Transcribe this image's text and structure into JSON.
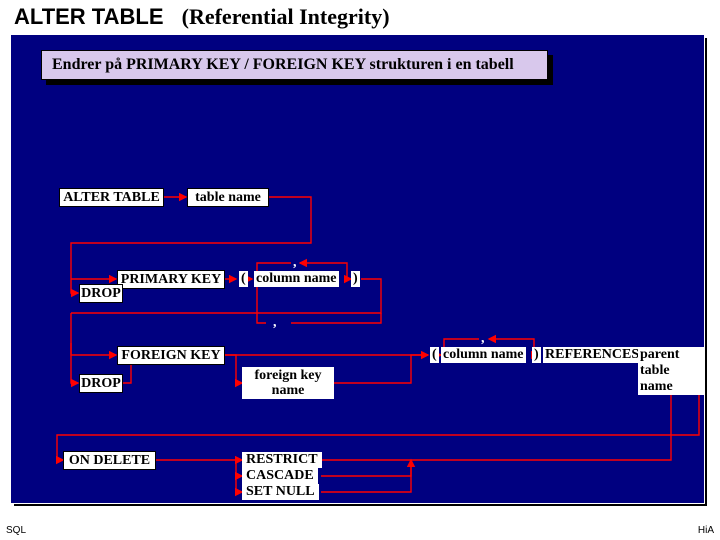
{
  "title": {
    "main": "ALTER TABLE",
    "sub": "(Referential Integrity)"
  },
  "banner": "Endrer på PRIMARY KEY / FOREIGN KEY strukturen i en tabell",
  "nodes": {
    "alter_table": "ALTER TABLE",
    "table_name": "table name",
    "primary_key": "PRIMARY KEY",
    "drop1": "DROP",
    "foreign_key": "FOREIGN KEY",
    "drop2": "DROP",
    "on_delete": "ON DELETE",
    "column_name1": "column name",
    "column_name2": "column name",
    "foreign_key_name": "foreign key\nname",
    "references": "REFERENCES",
    "parent_table": "parent table name",
    "restrict": "RESTRICT",
    "cascade": "CASCADE",
    "set_null": "SET NULL"
  },
  "symbols": {
    "lp": "(",
    "rp": ")",
    "comma": ","
  },
  "footer": {
    "left": "SQL",
    "right": "HiA"
  }
}
